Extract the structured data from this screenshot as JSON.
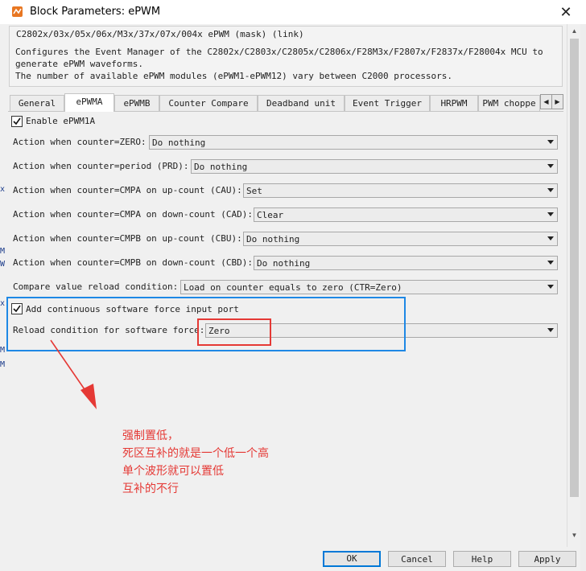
{
  "window": {
    "title": "Block Parameters: ePWM",
    "close_glyph": "✕",
    "app_icon": "simulink-block-icon"
  },
  "mask": {
    "title": "C2802x/03x/05x/06x/M3x/37x/07x/004x ePWM (mask) (link)",
    "description_lines": [
      "Configures the Event Manager of the C2802x/C2803x/C2805x/C2806x/F28M3x/F2807x/F2837x/F28004x MCU to",
      "generate ePWM waveforms.",
      "The number of available ePWM modules (ePWM1-ePWM12) vary between C2000 processors."
    ]
  },
  "tabs": [
    {
      "label": "General",
      "active": false
    },
    {
      "label": "ePWMA",
      "active": true
    },
    {
      "label": "ePWMB",
      "active": false
    },
    {
      "label": "Counter Compare",
      "active": false
    },
    {
      "label": "Deadband unit",
      "active": false
    },
    {
      "label": "Event Trigger",
      "active": false
    },
    {
      "label": "HRPWM",
      "active": false
    },
    {
      "label": "PWM choppe",
      "active": false
    }
  ],
  "tab_scroll": {
    "left": "◀",
    "right": "▶"
  },
  "enable": {
    "label": "Enable ePWM1A",
    "checked": true
  },
  "fields": [
    {
      "label": "Action when counter=ZERO:",
      "value": "Do nothing"
    },
    {
      "label": "Action when counter=period (PRD):",
      "value": "Do nothing"
    },
    {
      "label": "Action when counter=CMPA on up-count (CAU):",
      "value": "Set"
    },
    {
      "label": "Action when counter=CMPA on down-count (CAD):",
      "value": "Clear"
    },
    {
      "label": "Action when counter=CMPB on up-count (CBU):",
      "value": "Do nothing"
    },
    {
      "label": "Action when counter=CMPB on down-count (CBD):",
      "value": "Do nothing"
    },
    {
      "label": "Compare value reload condition:",
      "value": "Load on counter equals to zero (CTR=Zero)"
    }
  ],
  "software_force": {
    "label": "Add continuous software force input port",
    "checked": true
  },
  "reload_force": {
    "label": "Reload condition for software force:",
    "value": "Zero"
  },
  "annotation": {
    "lines": [
      "强制置低，",
      "死区互补的就是一个低一个高",
      "单个波形就可以置低",
      "互补的不行"
    ],
    "color": "#e53935"
  },
  "highlight_colors": {
    "blue_box": "#1e88e5",
    "red_box": "#e53935"
  },
  "left_margin_fragments": [
    "x",
    "M",
    "W",
    "x",
    "M",
    "M"
  ],
  "buttons": {
    "ok": "OK",
    "cancel": "Cancel",
    "help": "Help",
    "apply": "Apply"
  }
}
